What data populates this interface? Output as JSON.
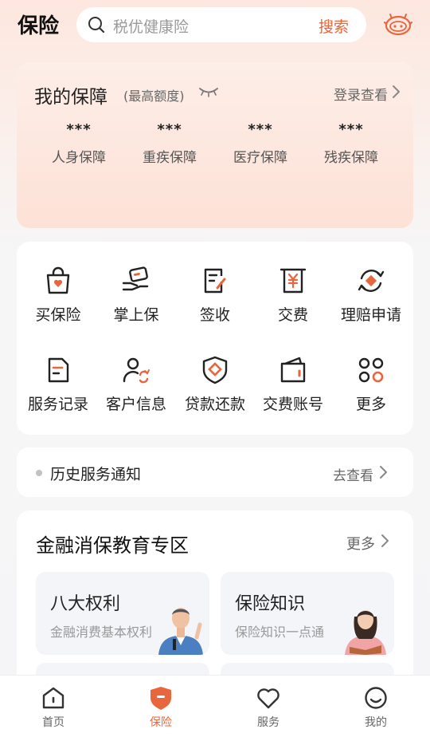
{
  "header": {
    "title": "保险",
    "search_placeholder": "税优健康险",
    "search_button": "搜索",
    "assistant_icon": "robot-assistant-icon"
  },
  "protection": {
    "title": "我的保障",
    "subtitle": "(最高额度)",
    "visibility_icon": "eye-closed-icon",
    "login_link": "登录查看",
    "items": [
      {
        "value": "***",
        "label": "人身保障"
      },
      {
        "value": "***",
        "label": "重疾保障"
      },
      {
        "value": "***",
        "label": "医疗保障"
      },
      {
        "value": "***",
        "label": "残疾保障"
      }
    ]
  },
  "services": {
    "items": [
      {
        "label": "买保险",
        "icon": "shopping-bag-icon"
      },
      {
        "label": "掌上保",
        "icon": "hand-card-icon"
      },
      {
        "label": "签收",
        "icon": "sign-document-icon"
      },
      {
        "label": "交费",
        "icon": "payment-yuan-icon"
      },
      {
        "label": "理赔申请",
        "icon": "claim-cycle-icon"
      },
      {
        "label": "服务记录",
        "icon": "record-document-icon"
      },
      {
        "label": "客户信息",
        "icon": "user-refresh-icon"
      },
      {
        "label": "贷款还款",
        "icon": "loan-shield-icon"
      },
      {
        "label": "交费账号",
        "icon": "wallet-icon"
      },
      {
        "label": "更多",
        "icon": "grid-more-icon"
      }
    ]
  },
  "notice": {
    "text": "历史服务通知",
    "action": "去查看"
  },
  "education": {
    "title": "金融消保教育专区",
    "more": "更多",
    "cards": [
      {
        "title": "八大权利",
        "subtitle": "金融消费基本权利"
      },
      {
        "title": "保险知识",
        "subtitle": "保险知识一点通"
      }
    ]
  },
  "tabbar": {
    "active": "保险",
    "items": [
      {
        "label": "首页",
        "icon": "home-icon"
      },
      {
        "label": "保险",
        "icon": "insurance-shield-icon"
      },
      {
        "label": "服务",
        "icon": "heart-icon"
      },
      {
        "label": "我的",
        "icon": "smile-profile-icon"
      }
    ]
  },
  "colors": {
    "accent": "#e8663d",
    "card_bg": "#ffffff",
    "protection_bg": "#fde1d6"
  }
}
